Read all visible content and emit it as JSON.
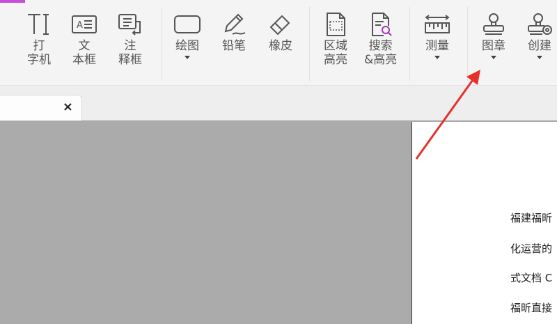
{
  "toolbar": {
    "tools": [
      {
        "label": "打\n字机"
      },
      {
        "label": "文\n本框"
      },
      {
        "label": "注\n释框"
      },
      {
        "label": "绘图"
      },
      {
        "label": "铅笔"
      },
      {
        "label": "橡皮"
      },
      {
        "label": "区域\n高亮"
      },
      {
        "label": "搜索\n&高亮"
      },
      {
        "label": "测量"
      },
      {
        "label": "图章"
      },
      {
        "label": "创建"
      }
    ],
    "icons": [
      "typewriter-icon",
      "textbox-icon",
      "callout-icon",
      "rectangle-icon",
      "pencil-icon",
      "eraser-icon",
      "area-highlight-icon",
      "search-highlight-icon",
      "ruler-icon",
      "stamp-icon",
      "create-stamp-icon"
    ]
  },
  "tab": {
    "close_label": "×"
  },
  "document": {
    "lines": [
      "福建福昕",
      "化运营的",
      "式文档 C",
      "福昕直接"
    ]
  },
  "colors": {
    "accent": "#c64fd9",
    "annotation_arrow": "#e8302a",
    "canvas": "#ababab"
  }
}
